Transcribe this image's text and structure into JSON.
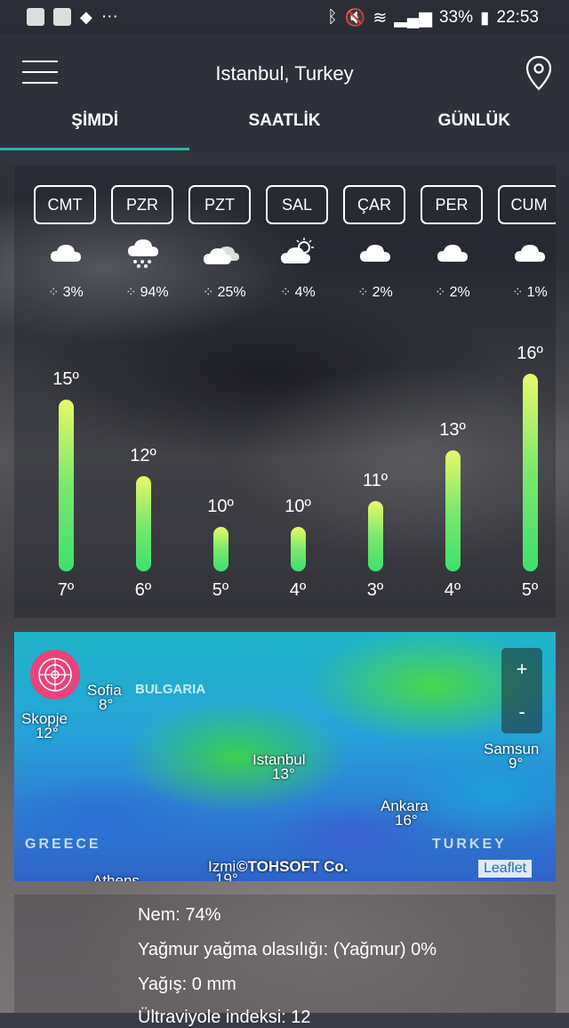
{
  "status": {
    "battery": "33%",
    "time": "22:53",
    "notif_more": "···"
  },
  "header": {
    "title": "Istanbul, Turkey"
  },
  "tabs": [
    "ŞİMDİ",
    "SAATLİK",
    "GÜNLÜK"
  ],
  "days": [
    {
      "label": "CMT",
      "precip": "3%",
      "icon": "cloud-icon",
      "high": "15º",
      "low": "7º"
    },
    {
      "label": "PZR",
      "precip": "94%",
      "icon": "rain-cloud-icon",
      "high": "12º",
      "low": "6º"
    },
    {
      "label": "PZT",
      "precip": "25%",
      "icon": "double-cloud-icon",
      "high": "10º",
      "low": "5º"
    },
    {
      "label": "SAL",
      "precip": "4%",
      "icon": "partly-sunny-icon",
      "high": "10º",
      "low": "4º"
    },
    {
      "label": "ÇAR",
      "precip": "2%",
      "icon": "cloud-icon",
      "high": "11º",
      "low": "3º"
    },
    {
      "label": "PER",
      "precip": "2%",
      "icon": "cloud-icon",
      "high": "13º",
      "low": "4º"
    },
    {
      "label": "CUM",
      "precip": "1%",
      "icon": "cloud-icon",
      "high": "16º",
      "low": "5º"
    }
  ],
  "map": {
    "labels": {
      "sofia": "Sofia",
      "sofia_temp": "8°",
      "bulgaria": "BULGARIA",
      "skopje": "Skopje",
      "skopje_temp": "12°",
      "istanbul": "Istanbul",
      "istanbul_temp": "13°",
      "samsun": "Samsun",
      "samsun_temp": "9°",
      "ankara": "Ankara",
      "ankara_temp": "16°",
      "greece": "GREECE",
      "turkey": "TURKEY",
      "izmir": "Izmi",
      "izmir_temp": "19°",
      "athens": "Athens"
    },
    "zoom_in": "+",
    "zoom_out": "-",
    "attribution": "Leaflet",
    "watermark": "©TOHSOFT Co."
  },
  "details": {
    "humidity": "Nem: 74%",
    "rain_chance": "Yağmur yağma olasılığı: (Yağmur) 0%",
    "precipitation": "Yağış: 0 mm",
    "uv_partial": "Ültraviyole indeksi: 12"
  }
}
